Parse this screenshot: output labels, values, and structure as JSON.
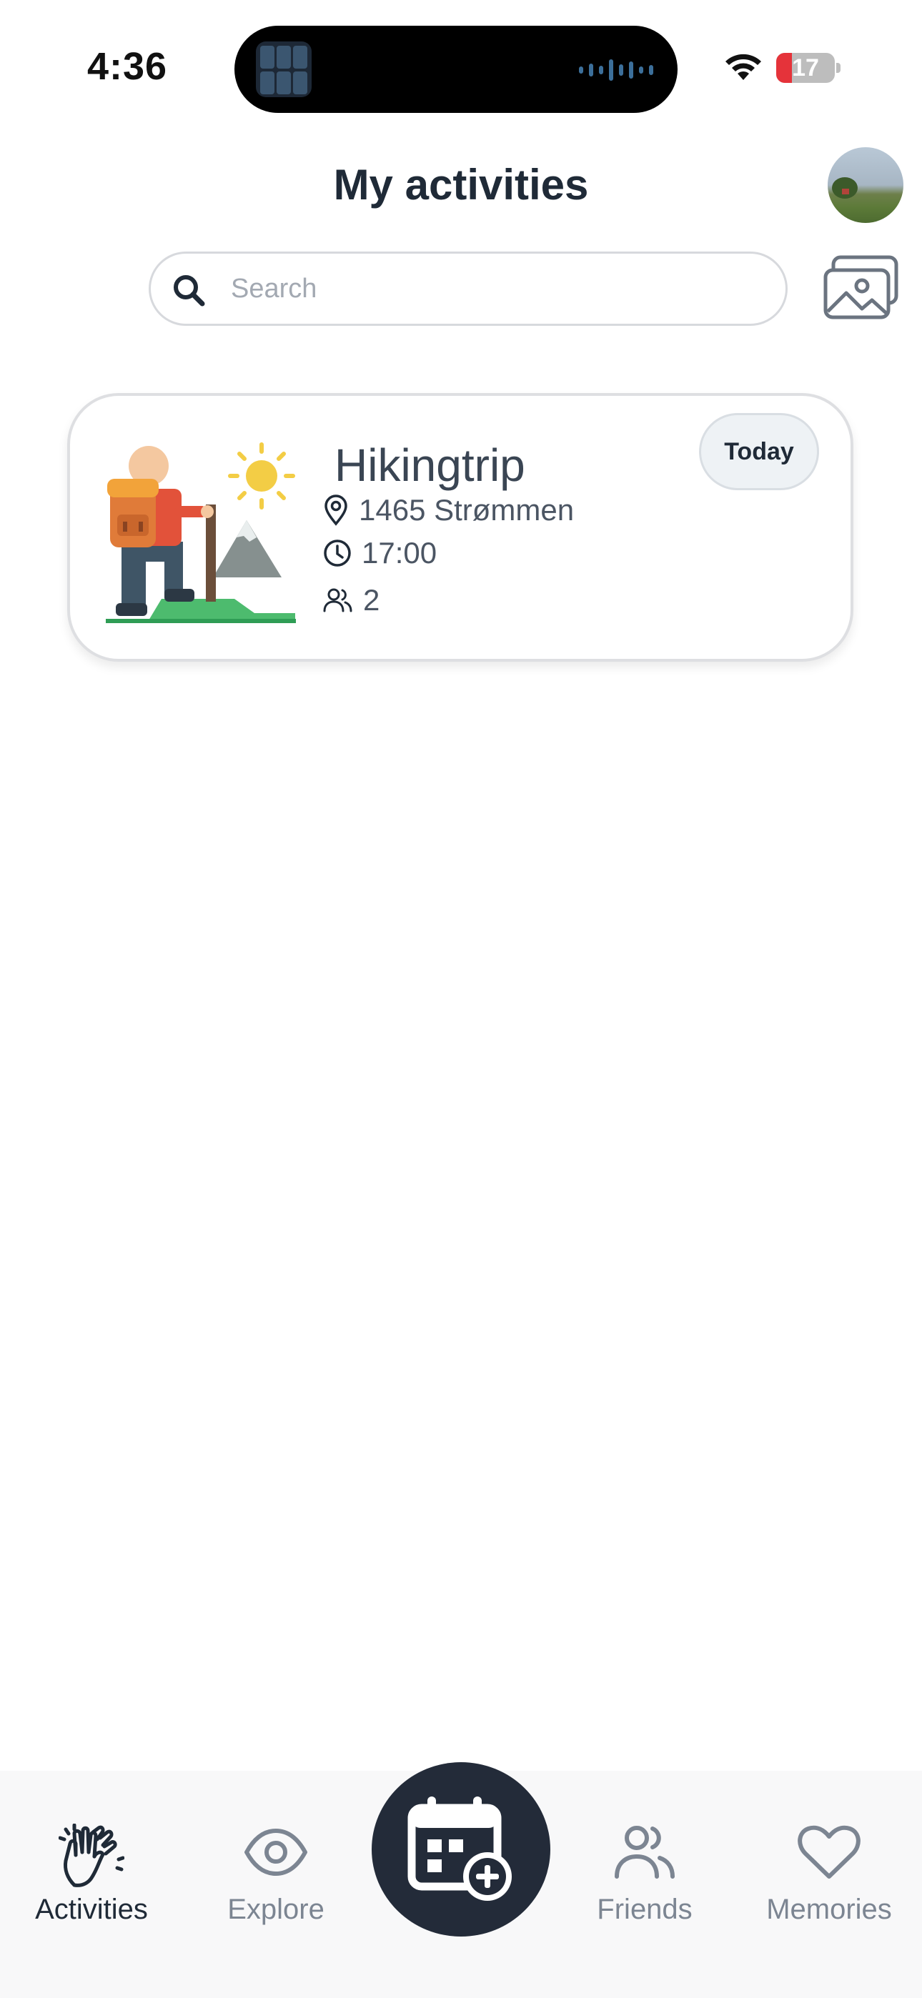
{
  "status_bar": {
    "time": "4:36",
    "battery_level": "17",
    "battery_fraction": 0.17,
    "icons": [
      "dynamic-island",
      "wifi-icon",
      "battery-icon"
    ]
  },
  "header": {
    "title": "My activities",
    "avatar_icon": "profile-photo"
  },
  "search": {
    "placeholder": "Search",
    "value": "",
    "icon": "search-icon"
  },
  "gallery_button": {
    "icon": "photos-icon"
  },
  "activities": [
    {
      "title": "Hikingtrip",
      "location": "1465 Strømmen",
      "time": "17:00",
      "participants": "2",
      "badge": "Today",
      "illustration": "hiker-mountain-illustration"
    }
  ],
  "bottom_nav": {
    "items": [
      {
        "label": "Activities",
        "icon": "clapping-hands-icon",
        "active": true
      },
      {
        "label": "Explore",
        "icon": "eye-icon",
        "active": false
      },
      {
        "label": "Friends",
        "icon": "friends-icon",
        "active": false
      },
      {
        "label": "Memories",
        "icon": "heart-icon",
        "active": false
      }
    ],
    "create_button_icon": "calendar-plus-icon"
  },
  "colors": {
    "primary_dark": "#232b39",
    "text": "#1f2a37",
    "muted": "#7c8592",
    "battery_low": "#e5333a"
  }
}
